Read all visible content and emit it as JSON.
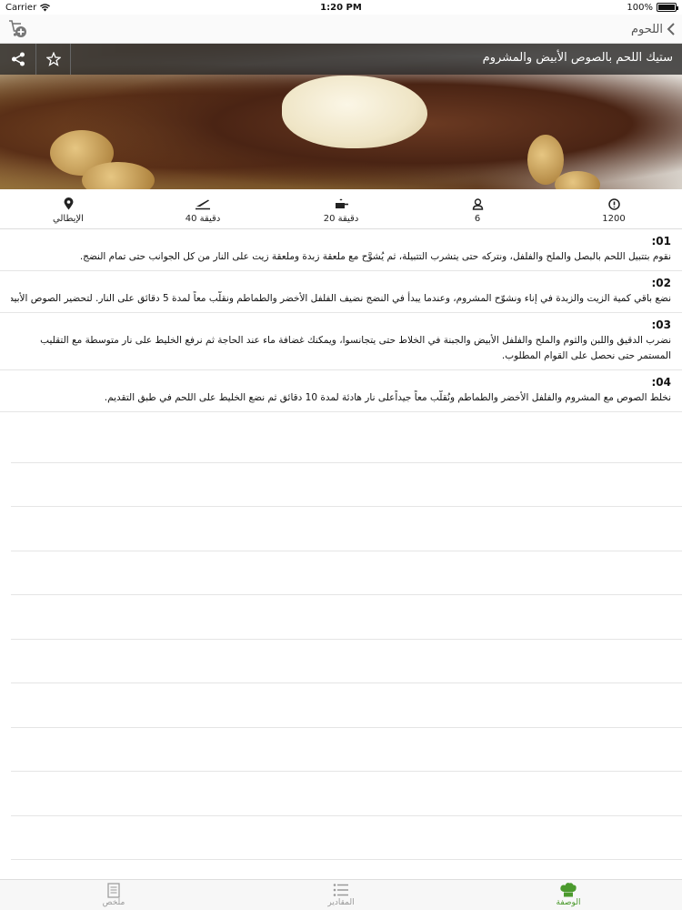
{
  "status_bar": {
    "carrier": "Carrier",
    "time": "1:20 PM",
    "battery": "100%",
    "battery_level": 1.0
  },
  "nav": {
    "back_label": "اللحوم",
    "cart_icon": "cart-add-icon",
    "back_icon": "chevron-left-icon"
  },
  "recipe": {
    "title": "ستيك اللحم بالصوص الأبيض والمشروم"
  },
  "info": {
    "calories": "1200",
    "servings": "6",
    "cook_time": "20 دقيقة",
    "prep_time": "40 دقيقة",
    "cuisine": "الإيطالي"
  },
  "steps": [
    {
      "num": ":01",
      "text": "نقوم بتتبيل اللحم بالبصل والملح والفلفل، ونتركه حتى يتشرب التتبيلة، ثم يُشوَّح مع ملعقة زبدة وملعقة زيت على النار من كل الجوانب حتى تمام النضج."
    },
    {
      "num": ":02",
      "text": "نضع باقي كمية الزيت والزبدة في إناء ونشوّح المشروم، وعندما يبدأ في النضج نضيف الفلفل الأخضر والطماطم ونقلّب معاً لمدة 5 دقائق على النار. لتحضير الصوص الأبيض"
    },
    {
      "num": ":03",
      "text": "نضرب الدقيق واللبن والثوم والملح والفلفل الأبيض والجبنة في الخلاط حتى يتجانسوا، ويمكنك غضافة ماء عند الحاجة ثم نرفع الخليط على نار متوسطة مع التقليب المستمر حتى نحصل على القوام المطلوب."
    },
    {
      "num": ":04",
      "text": "نخلط الصوص مع المشروم والفلفل الأخضر والطماطم ونُقلّب معاً جيداًعلى نار هادئة لمدة 10 دقائق ثم نضع الخليط على اللحم في طبق التقديم."
    }
  ],
  "tabs": {
    "summary": "ملخص",
    "ingredients": "المقادير",
    "recipe": "الوصفة"
  },
  "colors": {
    "accent": "#4b9a2d",
    "title_bar": "#282828"
  }
}
